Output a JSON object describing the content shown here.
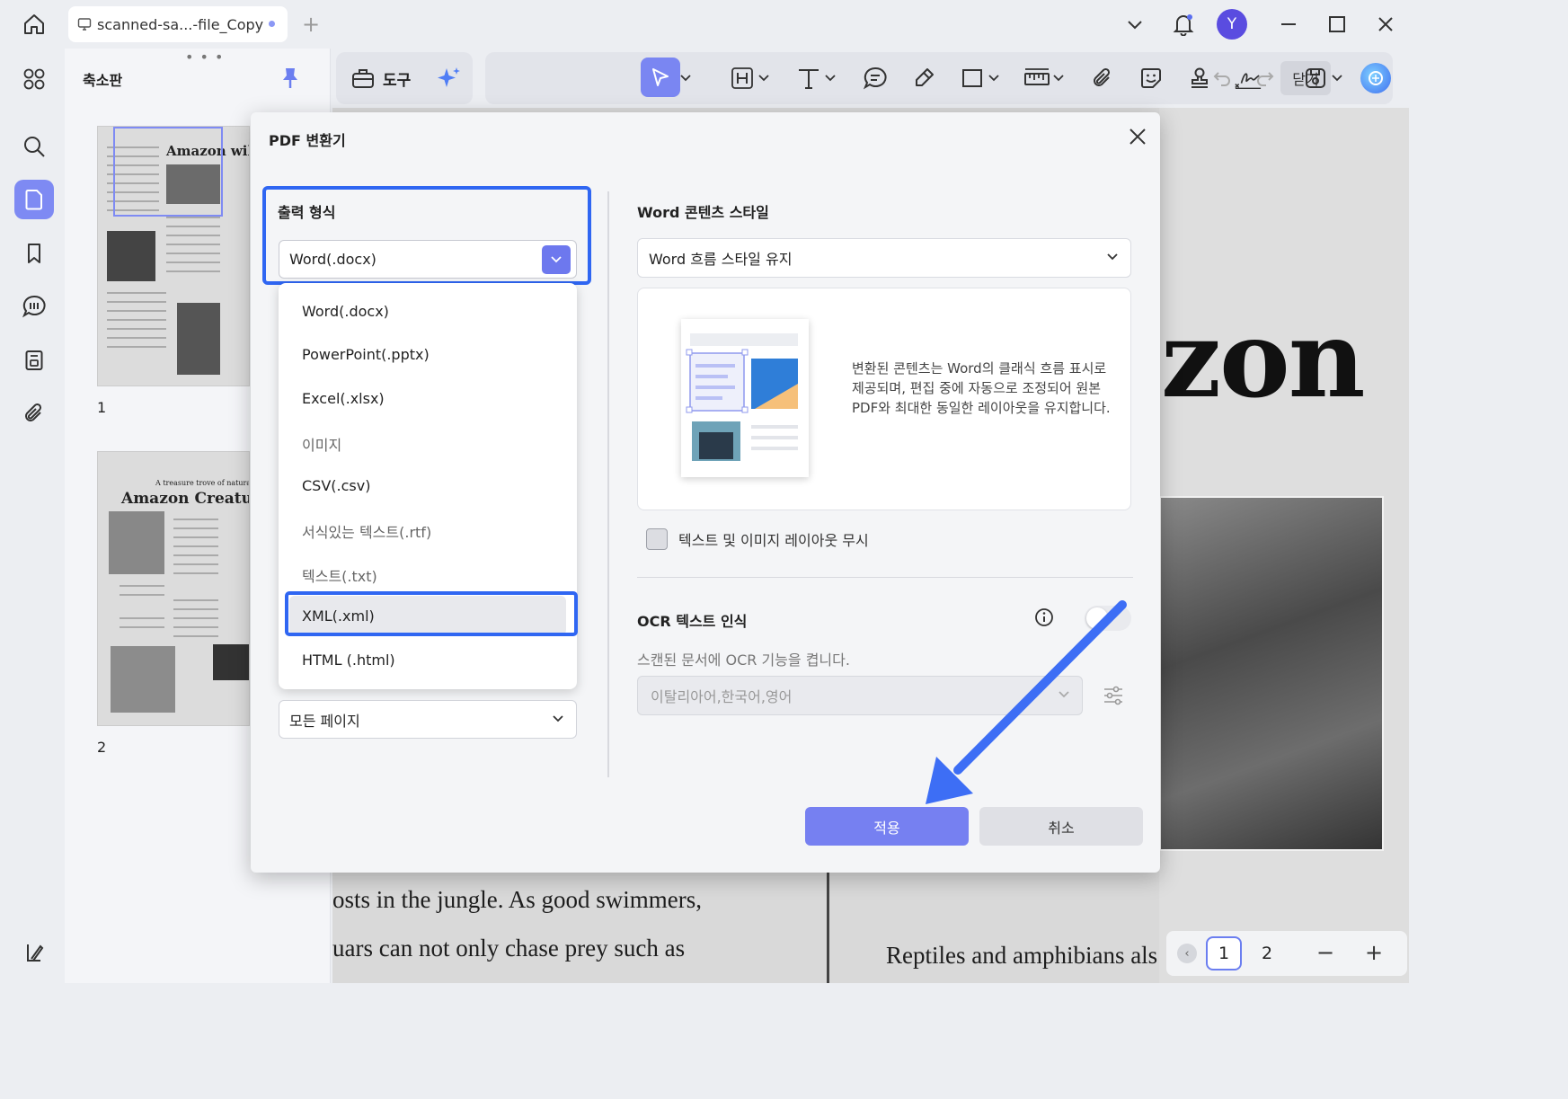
{
  "tab": {
    "title": "scanned-sa...-file_Copy"
  },
  "user": {
    "avatar_letter": "Y"
  },
  "thumbnails": {
    "title": "축소판",
    "pages": [
      {
        "label": "1",
        "heading": "Amazon wild"
      },
      {
        "label": "2",
        "heading": "Amazon Creatu",
        "subheading": "A treasure trove of natural life."
      }
    ]
  },
  "toolbar": {
    "tools_label": "도구",
    "close_label": "닫기"
  },
  "document": {
    "big_text": "zon",
    "line1": "osts in the jungle. As good swimmers,",
    "line2": "uars can not only chase prey such as",
    "line3": "Reptiles and amphibians als"
  },
  "pager": {
    "page1": "1",
    "page2": "2",
    "zoom_out": "−",
    "zoom_in": "+"
  },
  "dialog": {
    "title": "PDF 변환기",
    "output_format_label": "출력 형식",
    "selected_format": "Word(.docx)",
    "formats": [
      "Word(.docx)",
      "PowerPoint(.pptx)",
      "Excel(.xlsx)",
      "이미지",
      "CSV(.csv)",
      "서식있는 텍스트(.rtf)",
      "텍스트(.txt)",
      "XML(.xml)",
      "HTML (.html)"
    ],
    "highlighted_format_index": 7,
    "page_range": "모든 페이지",
    "word_style_label": "Word 콘텐츠 스타일",
    "word_style_value": "Word 흐름 스타일 유지",
    "style_description": "변환된 콘텐츠는 Word의 클래식 흐름 표시로 제공되며, 편집 중에 자동으로 조정되어 원본 PDF와 최대한 동일한 레이아웃을 유지합니다.",
    "ignore_layout_label": "텍스트 및 이미지 레이아웃 무시",
    "ignore_layout_checked": false,
    "ocr_label": "OCR 텍스트 인식",
    "ocr_enabled": false,
    "ocr_hint": "스캔된 문서에 OCR 기능을 켭니다.",
    "ocr_languages": "이탈리아어,한국어,영어",
    "apply_label": "적용",
    "cancel_label": "취소"
  },
  "colors": {
    "accent": "#7680f1",
    "highlight_border": "#2f66f2",
    "arrow": "#3d6ef5"
  },
  "icons": [
    "home-icon",
    "monitor-icon",
    "plus-icon",
    "chevron-down-icon",
    "bell-icon",
    "minimize-icon",
    "maximize-icon",
    "close-icon",
    "grid-icon",
    "search-icon",
    "page-icon",
    "bookmark-icon",
    "comment-icon",
    "form-icon",
    "paperclip-icon",
    "layers-icon",
    "pin-icon",
    "toolbox-icon",
    "sparkle-icon",
    "pointer-icon",
    "heading-icon",
    "text-icon",
    "note-icon",
    "highlighter-icon",
    "rectangle-icon",
    "ruler-icon",
    "sticker-icon",
    "stamp-icon",
    "signature-icon",
    "undo-icon",
    "redo-icon",
    "save-icon",
    "ai-assistant-icon",
    "info-icon",
    "settings-sliders-icon"
  ]
}
